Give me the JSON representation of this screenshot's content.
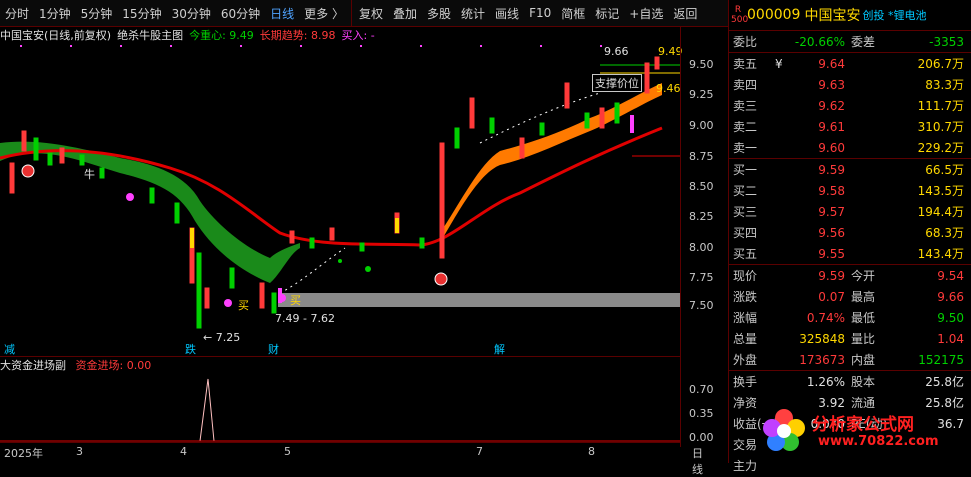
{
  "toolbar": {
    "periods": [
      "分时",
      "1分钟",
      "5分钟",
      "15分钟",
      "30分钟",
      "60分钟",
      "日线",
      "更多 〉"
    ],
    "active_period": "日线",
    "buttons": [
      "复权",
      "叠加",
      "多股",
      "统计",
      "画线",
      "F10",
      "简框",
      "标记",
      "+自选",
      "返回"
    ]
  },
  "chart_info": {
    "stock_name": "中国宝安(日线,前复权)",
    "indicator": "绝杀牛股主图",
    "cur_line": "今重心: 9.49",
    "trend": "长期趋势: 8.98",
    "buy": "买入: -"
  },
  "y_axis": [
    "9.50",
    "9.25",
    "9.00",
    "8.75",
    "8.50",
    "8.25",
    "8.00",
    "7.75",
    "7.50"
  ],
  "annotations": {
    "top_price": "9.66",
    "top_right": "9.49",
    "support": "支撑价位",
    "support_val": "9.46",
    "low_price": "7.25",
    "low_range": "7.49 - 7.62",
    "buy1": "买",
    "buy2": "买",
    "label_cow": "牛"
  },
  "event_tags": [
    "减",
    "跌",
    "财",
    "解"
  ],
  "sub_panel": {
    "name": "大资金进场副",
    "value": "资金进场: 0.00",
    "y_axis": [
      "0.70",
      "0.35",
      "0.00"
    ]
  },
  "date_axis": [
    "2025年",
    "3",
    "4",
    "5",
    "7",
    "8"
  ],
  "date_mode": "日线",
  "quote": {
    "code_badge_r": "R",
    "code_badge_num": "500",
    "code": "000009",
    "name": "中国宝安",
    "tags": "创投 *锂电池",
    "weibi_label": "委比",
    "weibi": "-20.66%",
    "weicha_label": "委差",
    "weicha": "-3353",
    "sell": [
      {
        "label": "卖五",
        "flag": "¥",
        "price": "9.64",
        "vol": "206.7万"
      },
      {
        "label": "卖四",
        "flag": "",
        "price": "9.63",
        "vol": "83.3万"
      },
      {
        "label": "卖三",
        "flag": "",
        "price": "9.62",
        "vol": "111.7万"
      },
      {
        "label": "卖二",
        "flag": "",
        "price": "9.61",
        "vol": "310.7万"
      },
      {
        "label": "卖一",
        "flag": "",
        "price": "9.60",
        "vol": "229.2万"
      }
    ],
    "buy": [
      {
        "label": "买一",
        "price": "9.59",
        "vol": "66.5万"
      },
      {
        "label": "买二",
        "price": "9.58",
        "vol": "143.5万"
      },
      {
        "label": "买三",
        "price": "9.57",
        "vol": "194.4万"
      },
      {
        "label": "买四",
        "price": "9.56",
        "vol": "68.3万"
      },
      {
        "label": "买五",
        "price": "9.55",
        "vol": "143.4万"
      }
    ],
    "stats": [
      {
        "l1": "现价",
        "v1": "9.59",
        "c1": "red",
        "l2": "今开",
        "v2": "9.54",
        "c2": "red"
      },
      {
        "l1": "涨跌",
        "v1": "0.07",
        "c1": "red",
        "l2": "最高",
        "v2": "9.66",
        "c2": "red"
      },
      {
        "l1": "涨幅",
        "v1": "0.74%",
        "c1": "red",
        "l2": "最低",
        "v2": "9.50",
        "c2": "green"
      },
      {
        "l1": "总量",
        "v1": "325848",
        "c1": "yellow",
        "l2": "量比",
        "v2": "1.04",
        "c2": "red"
      },
      {
        "l1": "外盘",
        "v1": "173673",
        "c1": "red",
        "l2": "内盘",
        "v2": "152175",
        "c2": "green"
      }
    ],
    "stats2": [
      {
        "l1": "换手",
        "v1": "1.26%",
        "l2": "股本",
        "v2": "25.8亿"
      },
      {
        "l1": "净资",
        "v1": "3.92",
        "l2": "流通",
        "v2": "25.8亿"
      },
      {
        "l1": "收益(一)",
        "v1": "0.070",
        "l2": "PE(动)",
        "v2": "36.7"
      },
      {
        "l1": "交易",
        "v1": "",
        "l2": "",
        "v2": ""
      },
      {
        "l1": "主力",
        "v1": "",
        "l2": "",
        "v2": ""
      }
    ]
  },
  "watermark": {
    "line1": "分析家公式网",
    "line2": "www.70822.com"
  },
  "colors": {
    "up": "#ff3a3a",
    "down": "#00d000",
    "ma_red": "#e00000",
    "band_orange": "#ff7a00",
    "band_green": "#1a8a1a"
  }
}
